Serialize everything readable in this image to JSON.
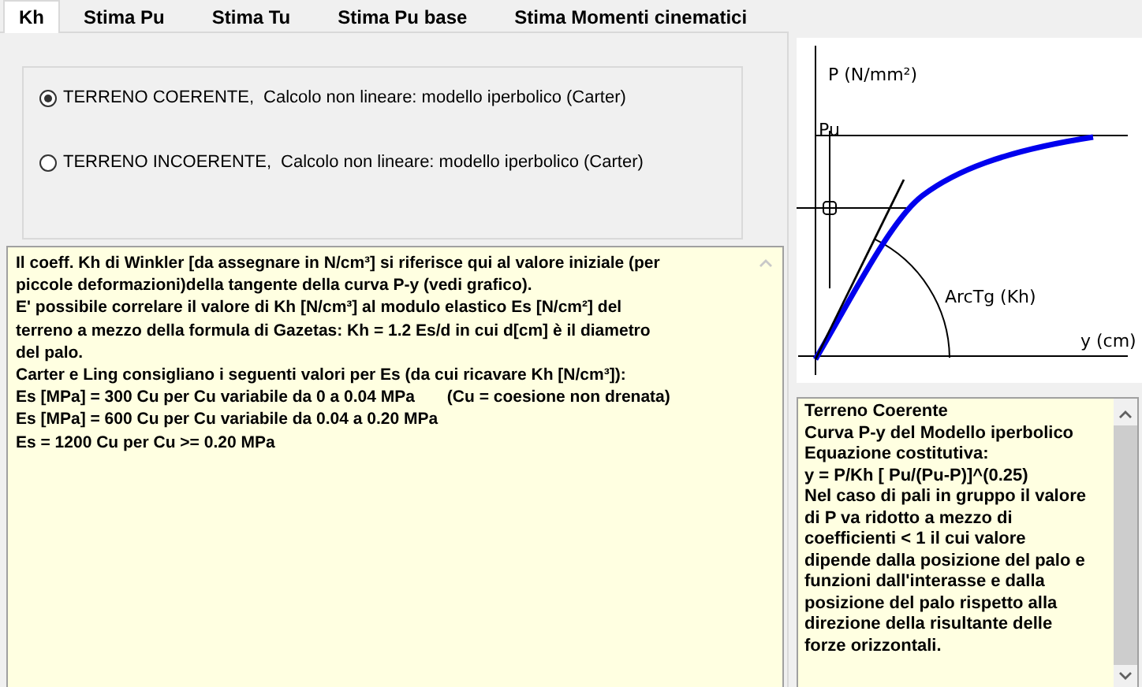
{
  "tabs": [
    {
      "label": "Kh",
      "selected": true
    },
    {
      "label": "Stima Pu",
      "selected": false
    },
    {
      "label": "Stima Tu",
      "selected": false
    },
    {
      "label": "Stima Pu base",
      "selected": false
    },
    {
      "label": "Stima Momenti cinematici",
      "selected": false
    }
  ],
  "soil_options": [
    {
      "label": "TERRENO COERENTE,",
      "detail": "Calcolo non lineare: modello iperbolico (Carter)",
      "selected": true
    },
    {
      "label": "TERRENO INCOERENTE,",
      "detail": "Calcolo non lineare: modello iperbolico (Carter)",
      "selected": false
    }
  ],
  "description": [
    "Il coeff. Kh di Winkler [da assegnare in N/cm³] si riferisce qui al valore iniziale (per",
    "piccole deformazioni)della tangente della curva P-y (vedi grafico).",
    "E' possibile correlare il valore di Kh [N/cm³] al modulo elastico Es [N/cm²] del",
    "terreno a mezzo della formula di Gazetas: Kh = 1.2 Es/d in cui d[cm] è il diametro",
    "del palo.",
    "Carter e Ling consigliano i seguenti valori per Es (da cui ricavare Kh [N/cm³]):",
    "Es [MPa] = 300 Cu per Cu variabile da 0 a 0.04 MPa       (Cu = coesione non drenata)",
    "Es [MPa] = 600 Cu per Cu variabile da 0.04 a 0.20 MPa",
    "Es = 1200 Cu per Cu >= 0.20 MPa"
  ],
  "diagram": {
    "y_axis_label": "P (N/mm²)",
    "limit_label": "Pu",
    "angle_label": "ArcTg (Kh)",
    "x_axis_label": "y (cm)"
  },
  "model_notes": [
    "Terreno Coerente",
    "Curva P-y del Modello iperbolico",
    "Equazione costitutiva:",
    " y = P/Kh [ Pu/(Pu-P)]^(0.25)",
    "Nel caso di pali in gruppo il valore di P va ridotto a mezzo di coefficienti < 1 il cui valore dipende dalla posizione del palo e funzioni dall'interasse e dalla posizione del palo rispetto alla direzione della risultante delle forze orizzontali."
  ]
}
